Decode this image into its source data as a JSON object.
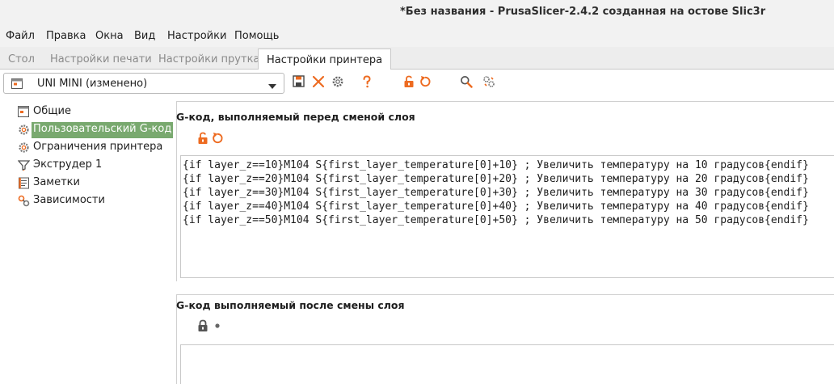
{
  "window": {
    "title": "*Без названия - PrusaSlicer-2.4.2 созданная на остове Slic3r"
  },
  "menu": [
    "Файл",
    "Правка",
    "Окна",
    "Вид",
    "Настройки",
    "Помощь"
  ],
  "tabs": [
    {
      "label": "Стол",
      "active": false
    },
    {
      "label": "Настройки печати",
      "active": false
    },
    {
      "label": "Настройки прутка",
      "active": false
    },
    {
      "label": "Настройки принтера",
      "active": true
    }
  ],
  "preset": {
    "name": "UNI MINI (изменено)"
  },
  "tree": [
    {
      "label": "Общие",
      "icon": "printer-icon",
      "selected": false
    },
    {
      "label": "Пользовательский G-код",
      "icon": "cog-icon",
      "selected": true
    },
    {
      "label": "Ограничения принтера",
      "icon": "cog-icon",
      "selected": false
    },
    {
      "label": "Экструдер 1",
      "icon": "funnel-icon",
      "selected": false
    },
    {
      "label": "Заметки",
      "icon": "note-icon",
      "selected": false
    },
    {
      "label": "Зависимости",
      "icon": "wrench-icon",
      "selected": false
    }
  ],
  "sections": {
    "before_layer_change": {
      "title": "G-код, выполняемый перед сменой слоя",
      "lines": [
        "{if layer_z==10}M104 S{first_layer_temperature[0]+10} ; Увеличить температуру на 10 градусов{endif}",
        "{if layer_z==20}M104 S{first_layer_temperature[0]+20} ; Увеличить температуру на 20 градусов{endif}",
        "{if layer_z==30}M104 S{first_layer_temperature[0]+30} ; Увеличить температуру на 30 градусов{endif}",
        "{if layer_z==40}M104 S{first_layer_temperature[0]+40} ; Увеличить температуру на 40 градусов{endif}",
        "{if layer_z==50}M104 S{first_layer_temperature[0]+50} ; Увеличить температуру на 50 градусов{endif}"
      ]
    },
    "after_layer_change": {
      "title": "G-код выполняемый после смены слоя"
    }
  },
  "colors": {
    "accent_orange": "#ed6b21",
    "selection_green": "#79a96f"
  }
}
